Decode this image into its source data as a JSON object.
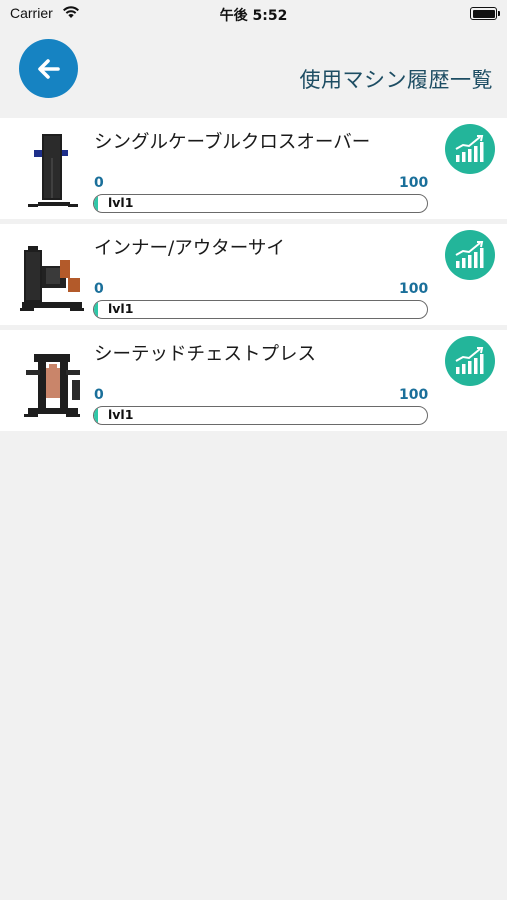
{
  "status_bar": {
    "carrier": "Carrier",
    "time": "午後 5:52",
    "battery_level": 1.0
  },
  "header": {
    "back_icon": "arrow-left-icon",
    "title": "使用マシン履歴一覧"
  },
  "colors": {
    "accent_blue": "#1683c2",
    "accent_teal": "#23b59a",
    "title_color": "#1d4d63",
    "range_color": "#1a6f9a",
    "background": "#f1f1f1"
  },
  "machines": [
    {
      "name": "シングルケーブルクロスオーバー",
      "min": "0",
      "max": "100",
      "level_label": "lvl1",
      "progress": 0.01,
      "thumb_icon": "cable-crossover-machine-image",
      "action_icon": "bar-chart-icon"
    },
    {
      "name": "インナー/アウターサイ",
      "min": "0",
      "max": "100",
      "level_label": "lvl1",
      "progress": 0.01,
      "thumb_icon": "inner-outer-thigh-machine-image",
      "action_icon": "bar-chart-icon"
    },
    {
      "name": "シーテッドチェストプレス",
      "min": "0",
      "max": "100",
      "level_label": "lvl1",
      "progress": 0.01,
      "thumb_icon": "seated-chest-press-machine-image",
      "action_icon": "bar-chart-icon"
    }
  ]
}
